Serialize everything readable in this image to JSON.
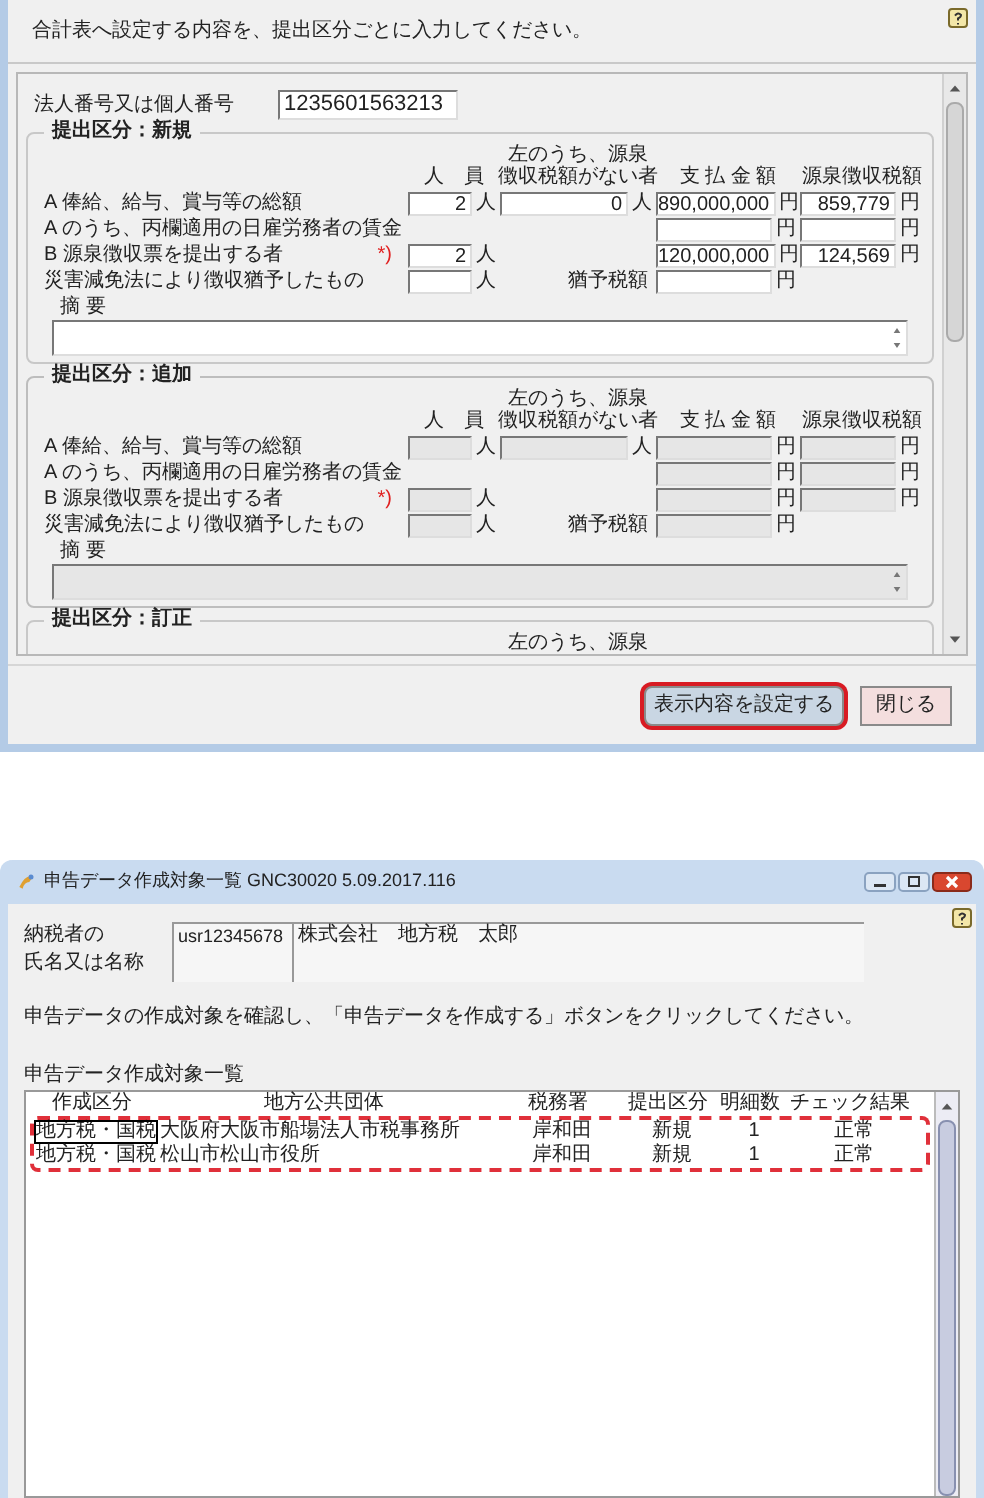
{
  "form_window": {
    "instruction": "合計表へ設定する内容を、提出区分ごとに入力してください。",
    "corporate_number": {
      "label": "法人番号又は個人番号",
      "value": "1235601563213"
    },
    "sections": [
      {
        "title": "提出区分：新規",
        "disabled": false,
        "columns": [
          {
            "kind": "persons",
            "lines": [
              "人　員"
            ]
          },
          {
            "kind": "exempt",
            "lines": [
              "左のうち、源泉",
              "徴収税額がない者"
            ]
          },
          {
            "kind": "payment",
            "lines": [
              "支 払 金 額"
            ]
          },
          {
            "kind": "tax",
            "lines": [
              "源泉徴収税額"
            ]
          }
        ],
        "rows": [
          {
            "kind": "full",
            "label": "A 俸給、給与、賞与等の総額",
            "persons": "2",
            "persons_unit": "人",
            "exempt": "0",
            "exempt_unit": "人",
            "payment": "890,000,000",
            "payment_unit": "円",
            "tax": "859,779",
            "tax_unit": "円"
          },
          {
            "kind": "amounts",
            "label": "A のうち、丙欄適用の日雇労務者の賃金",
            "payment_unit": "円",
            "tax_unit": "円"
          },
          {
            "kind": "noted",
            "label": "B 源泉徴収票を提出する者",
            "note": "*)",
            "persons": "2",
            "persons_unit": "人",
            "payment": "120,000,000",
            "payment_unit": "円",
            "tax": "124,569",
            "tax_unit": "円"
          },
          {
            "kind": "deferral",
            "label": "災害減免法により徴収猶予したもの",
            "persons_unit": "人",
            "deferred_label": "猶予税額",
            "payment_unit": "円"
          }
        ],
        "remarks_label": "摘 要"
      },
      {
        "title": "提出区分：追加",
        "disabled": true,
        "columns": [
          {
            "kind": "persons",
            "lines": [
              "人　員"
            ]
          },
          {
            "kind": "exempt",
            "lines": [
              "左のうち、源泉",
              "徴収税額がない者"
            ]
          },
          {
            "kind": "payment",
            "lines": [
              "支 払 金 額"
            ]
          },
          {
            "kind": "tax",
            "lines": [
              "源泉徴収税額"
            ]
          }
        ],
        "rows": [
          {
            "kind": "full",
            "label": "A 俸給、給与、賞与等の総額",
            "persons_unit": "人",
            "exempt_unit": "人",
            "payment_unit": "円",
            "tax_unit": "円"
          },
          {
            "kind": "amounts",
            "label": "A のうち、丙欄適用の日雇労務者の賃金",
            "payment_unit": "円",
            "tax_unit": "円"
          },
          {
            "kind": "noted",
            "label": "B 源泉徴収票を提出する者",
            "note": "*)",
            "persons_unit": "人",
            "payment_unit": "円",
            "tax_unit": "円"
          },
          {
            "kind": "deferral",
            "label": "災害減免法により徴収猶予したもの",
            "persons_unit": "人",
            "deferred_label": "猶予税額",
            "payment_unit": "円"
          }
        ],
        "remarks_label": "摘 要"
      },
      {
        "title": "提出区分：訂正",
        "columns": [
          {
            "kind": "exempt",
            "lines": [
              "左のうち、源泉"
            ]
          }
        ]
      }
    ],
    "buttons": [
      {
        "label": "表示内容を設定する",
        "kind": "confirm",
        "highlighted": true
      },
      {
        "label": "閉じる",
        "kind": "cancel",
        "highlighted": false
      }
    ]
  },
  "list_window": {
    "title": "申告データ作成対象一覧 GNC30020 5.09.2017.116",
    "taxpayer": {
      "label_lines": [
        "納税者の",
        "氏名又は名称"
      ],
      "user_id": "usr12345678",
      "name": "株式会社　地方税　太郎"
    },
    "instruction": "申告データの作成対象を確認し、「申告データを作成する」ボタンをクリックしてください。",
    "list_title": "申告データ作成対象一覧",
    "columns": [
      "作成区分",
      "地方公共団体",
      "税務署",
      "提出区分",
      "明細数",
      "チェック結果"
    ],
    "rows_highlighted": true,
    "rows": [
      {
        "cells": [
          "地方税・国税",
          "大阪府大阪市船場法人市税事務所",
          "岸和田",
          "新規",
          "1",
          "正常"
        ],
        "focused": true
      },
      {
        "cells": [
          "地方税・国税",
          "松山市松山市役所",
          "岸和田",
          "新規",
          "1",
          "正常"
        ],
        "focused": false
      }
    ]
  }
}
